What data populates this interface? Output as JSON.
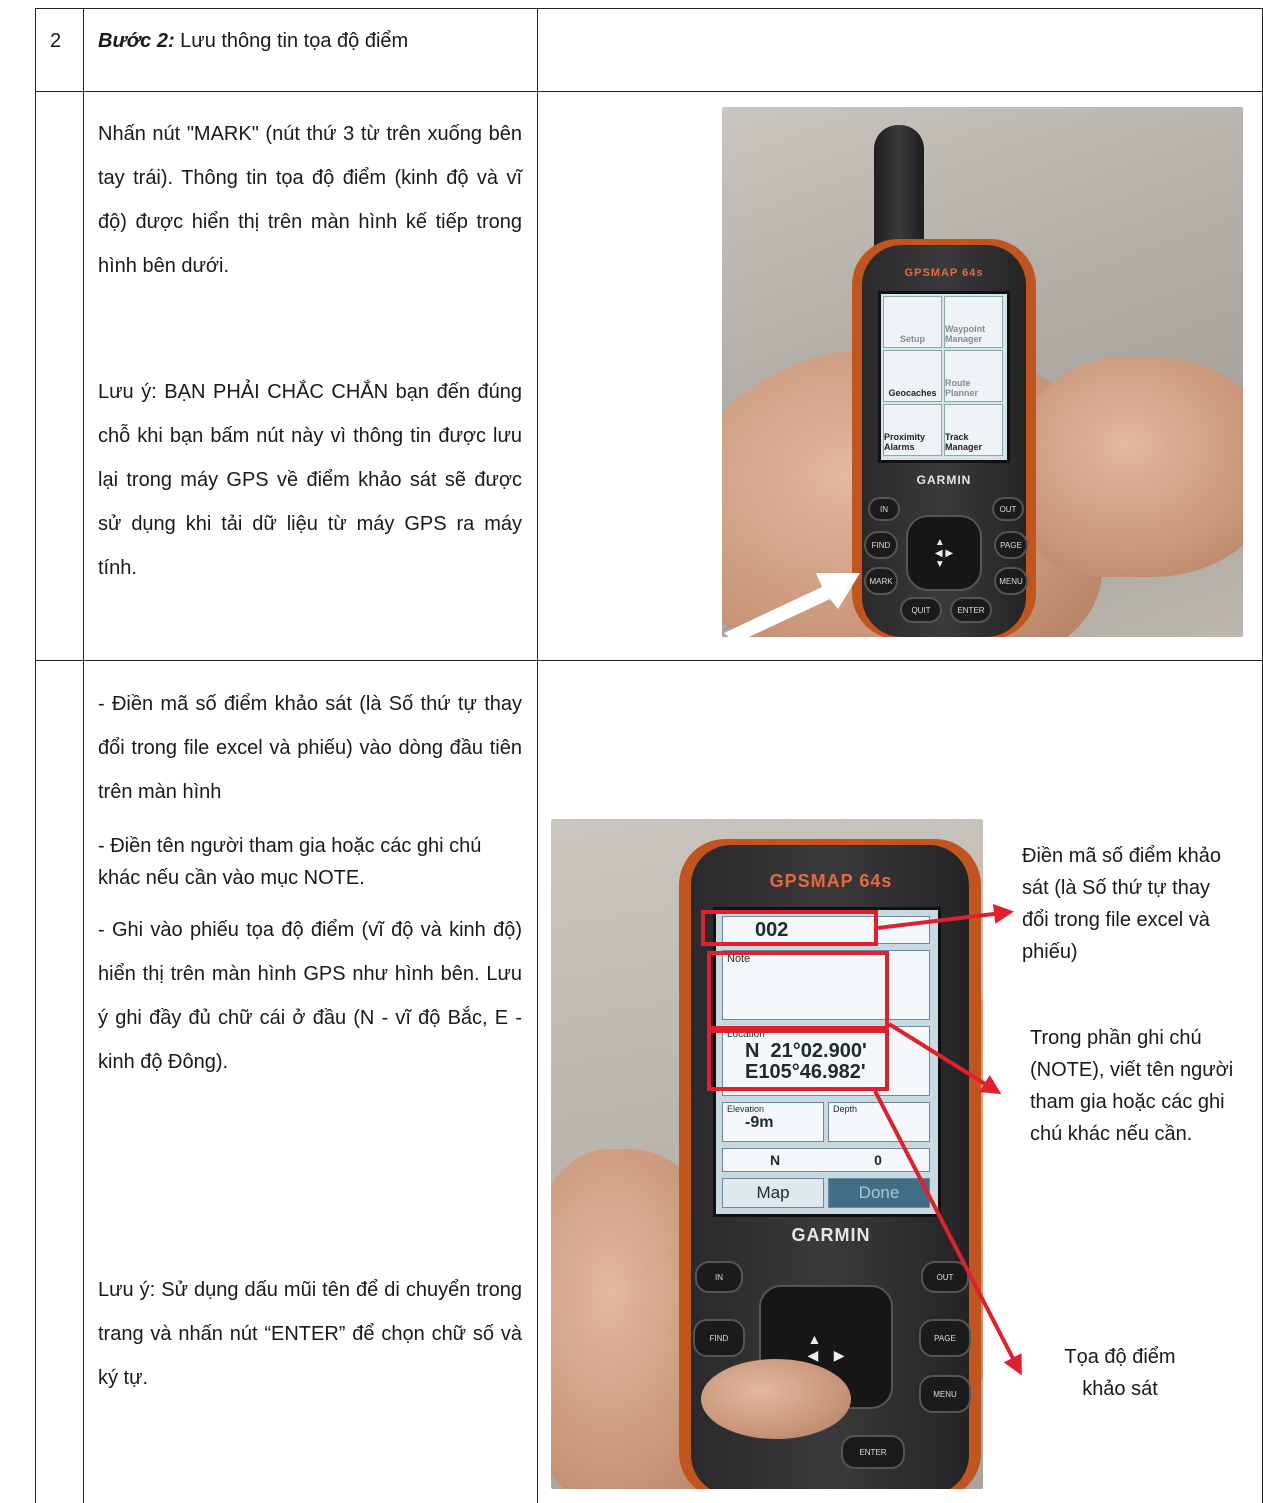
{
  "table": {
    "row1": {
      "number": "2",
      "step_label": "Bước 2:",
      "step_title": " Lưu thông tin tọa độ điểm"
    },
    "row2": {
      "instruction": "Nhấn nút \"MARK\" (nút thứ 3 từ trên xuống bên tay trái). Thông tin tọa độ điểm (kinh độ và vĩ độ) được hiển thị trên màn hình kế tiếp trong hình bên dưới.",
      "note": "Lưu ý: BẠN PHẢI CHẮC CHẮN bạn đến đúng chỗ khi bạn bấm nút này vì thông tin được lưu lại trong máy GPS về điểm khảo sát sẽ được sử dụng khi tải dữ liệu từ máy GPS ra máy tính.",
      "photo": {
        "device_model": "GPSMAP 64s",
        "device_brand": "GARMIN",
        "menu_tiles": [
          "Setup",
          "Waypoint Manager",
          "Geocaches",
          "Route Planner",
          "Proximity Alarms",
          "Track Manager"
        ],
        "buttons": [
          "IN",
          "OUT",
          "FIND",
          "PAGE",
          "MARK",
          "MENU",
          "QUIT",
          "ENTER"
        ]
      }
    },
    "row3": {
      "bullet1": "- Điền mã số điểm khảo sát (là Số thứ tự thay đổi trong file excel và phiếu) vào dòng đầu tiên trên màn hình",
      "bullet2": "- Điền tên người tham gia hoặc các ghi chú khác nếu cần vào mục NOTE.",
      "bullet3": "- Ghi vào phiếu tọa độ điểm (vĩ độ và kinh độ) hiển thị trên màn hình GPS như hình bên. Lưu ý ghi đầy đủ chữ cái ở đầu (N - vĩ độ Bắc, E - kinh độ Đông).",
      "note": "Lưu ý: Sử dụng dấu mũi tên để di chuyển trong trang và nhấn nút “ENTER” để chọn chữ số và ký tự.",
      "photo": {
        "device_model": "GPSMAP 64s",
        "device_brand": "GARMIN",
        "waypoint_name": "002",
        "note_label": "Note",
        "location_label": "Location",
        "lat": "N  21°02.900'",
        "lon": "E105°46.982'",
        "elevation_label": "Elevation",
        "elevation_value": "-9m",
        "depth_label": "Depth",
        "heading_value": "N",
        "zero_value": "0",
        "map_button": "Map",
        "done_button": "Done",
        "buttons": [
          "IN",
          "OUT",
          "FIND",
          "PAGE",
          "MENU",
          "ENTER"
        ]
      },
      "callouts": {
        "waypoint": "Điền mã số điểm khảo sát (là Số thứ tự thay đổi trong file excel và phiếu)",
        "note": "Trong phần ghi chú (NOTE), viết tên người tham gia hoặc các ghi chú khác nếu cần.",
        "coords": "Tọa độ điểm khảo sát"
      },
      "annotation_color": "#e0202a"
    }
  }
}
